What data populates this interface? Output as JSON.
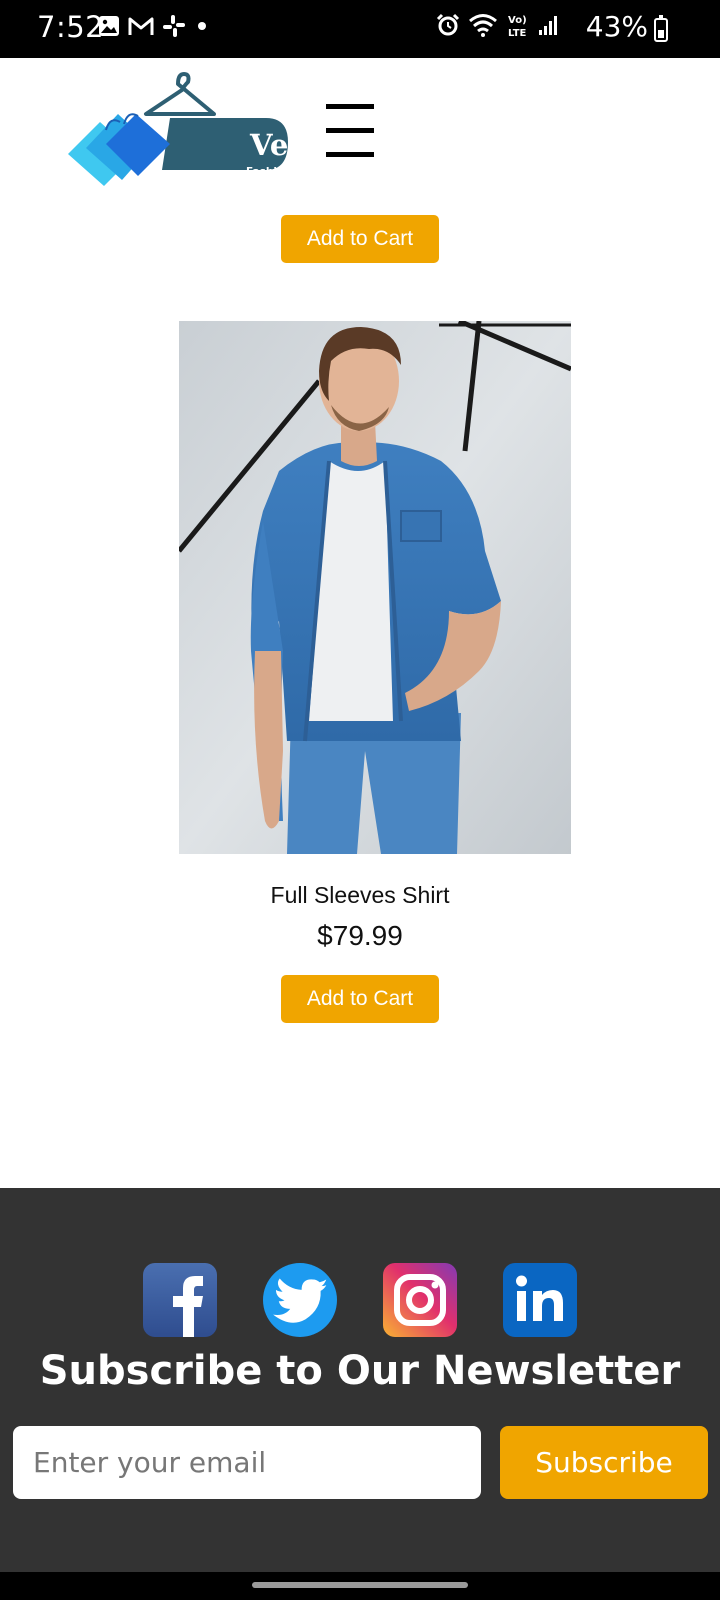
{
  "status_bar": {
    "time": "7:52",
    "battery_percent": "43%",
    "left_icons": [
      "gallery-icon",
      "gmail-icon",
      "slack-icon",
      "dot-icon"
    ],
    "right_icons": [
      "alarm-icon",
      "wifi-icon",
      "volte-icon",
      "signal-icon",
      "battery-icon"
    ]
  },
  "header": {
    "logo_name": "Vexia",
    "logo_tagline": "Fashion Collection",
    "menu_icon": "hamburger-menu-icon"
  },
  "products": {
    "previous_item": {
      "button_label": "Add to Cart"
    },
    "item": {
      "name": "Full Sleeves Shirt",
      "price": "$79.99",
      "button_label": "Add to Cart"
    }
  },
  "footer": {
    "social_icons": [
      "facebook-icon",
      "twitter-icon",
      "instagram-icon",
      "linkedin-icon"
    ],
    "newsletter_title": "Subscribe to Our Newsletter",
    "email_placeholder": "Enter your email",
    "subscribe_label": "Subscribe"
  },
  "colors": {
    "accent": "#f0a500",
    "footer_bg": "#333333",
    "logo_teal": "#2e5f73"
  }
}
